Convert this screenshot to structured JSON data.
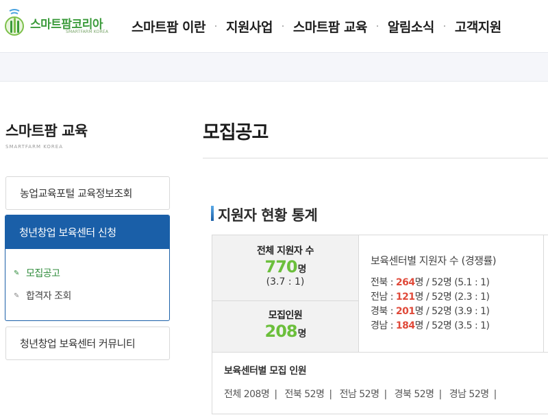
{
  "header": {
    "logo_text": "스마트팜코리아",
    "logo_sub": "SMARTFARM KOREA",
    "nav": [
      "스마트팜 이란",
      "지원사업",
      "스마트팜 교육",
      "알림소식",
      "고객지원"
    ]
  },
  "sidebar": {
    "title": "스마트팜 교육",
    "subtitle": "SMARTFARM KOREA",
    "items": [
      {
        "label": "농업교육포털 교육정보조회"
      },
      {
        "label": "청년창업 보육센터 신청",
        "active": true,
        "children": [
          {
            "label": "모집공고",
            "active": true
          },
          {
            "label": "합격자 조회"
          }
        ]
      },
      {
        "label": "청년창업 보육센터 커뮤니티"
      }
    ]
  },
  "main": {
    "page_title": "모집공고",
    "section_title": "지원자 현황 통계",
    "total": {
      "label": "전체 지원자 수",
      "value": "770",
      "unit": "명",
      "ratio": "(3.7 : 1)"
    },
    "recruit": {
      "label": "모집인원",
      "value": "208",
      "unit": "명"
    },
    "by_center": {
      "heading": "보육센터별 지원자 수 (경쟁률)",
      "rows": [
        {
          "region": "전북",
          "applicants": "264",
          "rest": "명 / 52명 (5.1 : 1)"
        },
        {
          "region": "전남",
          "applicants": "121",
          "rest": "명 / 52명 (2.3 : 1)"
        },
        {
          "region": "경북",
          "applicants": "201",
          "rest": "명 / 52명 (3.9 : 1)"
        },
        {
          "region": "경남",
          "applicants": "184",
          "rest": "명 / 52명 (3.5 : 1)"
        }
      ]
    },
    "recruit_by_center": {
      "heading": "보육센터별 모집 인원",
      "items": [
        "전체 208명",
        "전북 52명",
        "전남 52명",
        "경북 52명",
        "경남 52명"
      ]
    }
  },
  "colors": {
    "brand_blue": "#1a5fa8",
    "accent_green": "#6cbf3c",
    "highlight_red": "#e04a3a",
    "logo_green": "#3a9a3a"
  },
  "icons": [
    "smartfarm-logo-icon",
    "pencil-icon"
  ]
}
